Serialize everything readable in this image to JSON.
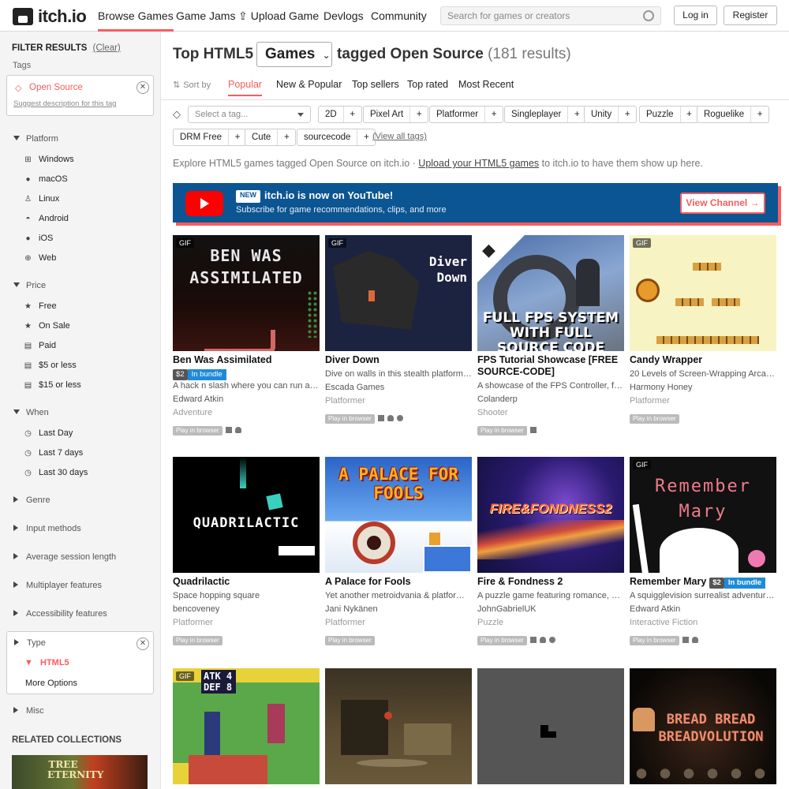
{
  "header": {
    "logo": "itch.io",
    "nav": [
      "Browse Games",
      "Game Jams",
      "Upload Game",
      "Devlogs",
      "Community"
    ],
    "search_placeholder": "Search for games or creators",
    "login": "Log in",
    "register": "Register"
  },
  "sidebar": {
    "filter_title": "FILTER RESULTS",
    "clear": "(Clear)",
    "tags_label": "Tags",
    "active_tag": "Open Source",
    "suggest": "Suggest description for this tag",
    "sections": [
      {
        "label": "Platform",
        "items": [
          "Windows",
          "macOS",
          "Linux",
          "Android",
          "iOS",
          "Web"
        ]
      },
      {
        "label": "Price",
        "items": [
          "Free",
          "On Sale",
          "Paid",
          "$5 or less",
          "$15 or less"
        ]
      },
      {
        "label": "When",
        "items": [
          "Last Day",
          "Last 7 days",
          "Last 30 days"
        ]
      }
    ],
    "collapsed": [
      "Genre",
      "Input methods",
      "Average session length",
      "Multiplayer features",
      "Accessibility features"
    ],
    "type_label": "Type",
    "type_value": "HTML5",
    "more_options": "More Options",
    "misc": "Misc",
    "related": "RELATED COLLECTIONS",
    "collection_label": "TREE ETERNITY"
  },
  "main": {
    "title_pre": "Top HTML5",
    "dropdown": "Games",
    "title_post": "tagged Open Source",
    "count": "(181 results)",
    "sort_label": "Sort by",
    "tabs": [
      "Popular",
      "New & Popular",
      "Top sellers",
      "Top rated",
      "Most Recent"
    ],
    "tag_select_placeholder": "Select a tag...",
    "tags_row1": [
      "2D",
      "Pixel Art",
      "Platformer",
      "Singleplayer",
      "Unity",
      "Puzzle",
      "Roguelike"
    ],
    "tags_row2": [
      "DRM Free",
      "Cute",
      "sourcecode"
    ],
    "view_all": "(View all tags)",
    "explore_pre": "Explore HTML5 games tagged Open Source on itch.io ·",
    "explore_link": "Upload your HTML5 games",
    "explore_post": "to itch.io to have them show up here.",
    "banner": {
      "new": "NEW",
      "title": "itch.io is now on YouTube!",
      "sub": "Subscribe for game recommendations, clips, and more",
      "button": "View Channel →"
    },
    "play_in_browser": "Play in browser",
    "games": [
      {
        "title": "Ben Was Assimilated",
        "price": "$2",
        "bundle": "In bundle",
        "desc": "A hack n slash where you can run aro…",
        "author": "Edward Atkin",
        "genre": "Adventure",
        "gif": "GIF",
        "art": "BEN WAS ASSIMILATED"
      },
      {
        "title": "Diver Down",
        "desc": "Dive on walls in this stealth platform…",
        "author": "Escada Games",
        "genre": "Platformer",
        "gif": "GIF",
        "art": "Diver Down"
      },
      {
        "title": "FPS Tutorial Showcase [FREE SOURCE-CODE]",
        "desc": "A showcase of the FPS Controller, fre…",
        "author": "Colanderp",
        "genre": "Shooter",
        "art": "FULL FPS SYSTEM WITH FULL SOURCE CODE"
      },
      {
        "title": "Candy Wrapper",
        "desc": "20 Levels of Screen-Wrapping Arcad…",
        "author": "Harmony Honey",
        "genre": "Platformer",
        "gif": "GIF"
      },
      {
        "title": "Quadrilactic",
        "desc": "Space hopping square",
        "author": "bencoveney",
        "genre": "Platformer",
        "art": "QUADRILACTIC"
      },
      {
        "title": "A Palace for Fools",
        "desc": "Yet another metroidvania & platform…",
        "author": "Jani Nykänen",
        "genre": "Platformer",
        "art": "A PALACE FOR FOOLS"
      },
      {
        "title": "Fire & Fondness 2",
        "desc": "A puzzle game featuring romance, ex…",
        "author": "JohnGabrielUK",
        "genre": "Puzzle",
        "art": "FIRE&FONDNESS2"
      },
      {
        "title": "Remember Mary",
        "price": "$2",
        "bundle": "In bundle",
        "desc": "A squigglevision surrealist adventure…",
        "author": "Edward Atkin",
        "genre": "Interactive Fiction",
        "gif": "GIF",
        "art": "Remember Mary"
      },
      {
        "gif": "GIF",
        "art": "ATK 4 DEF 8"
      },
      {},
      {},
      {
        "art": "BREAD BREAD BREADVOLUTION"
      }
    ]
  }
}
